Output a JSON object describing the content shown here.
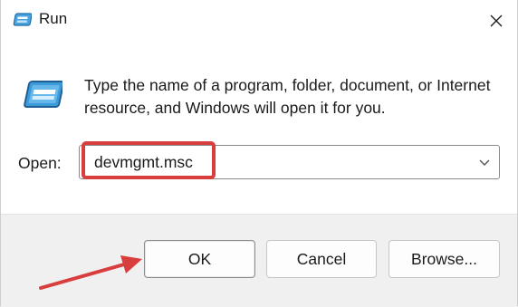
{
  "window": {
    "title": "Run",
    "title_icon": "run-icon",
    "close_icon": "close-icon"
  },
  "body": {
    "icon": "run-icon",
    "description": "Type the name of a program, folder, document, or Internet resource, and Windows will open it for you."
  },
  "open_field": {
    "label": "Open:",
    "value": "devmgmt.msc",
    "dropdown_icon": "chevron-down-icon"
  },
  "buttons": {
    "ok": "OK",
    "cancel": "Cancel",
    "browse": "Browse..."
  },
  "annotations": {
    "highlight_color": "#d93e3e",
    "arrow_color": "#d93e3e"
  }
}
